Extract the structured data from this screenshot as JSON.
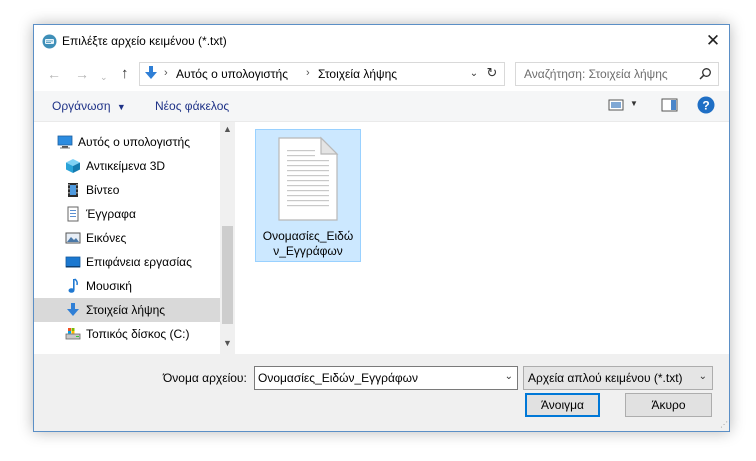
{
  "window": {
    "title": "Επιλέξτε αρχείο κειμένου (*.txt)"
  },
  "navigation": {
    "breadcrumb": [
      "Αυτός ο υπολογιστής",
      "Στοιχεία λήψης"
    ],
    "search_placeholder": "Αναζήτηση: Στοιχεία λήψης"
  },
  "toolbar": {
    "organize_label": "Οργάνωση",
    "new_folder_label": "Νέος φάκελος"
  },
  "sidebar": {
    "items": [
      {
        "label": "Αυτός ο υπολογιστής",
        "icon": "computer-icon"
      },
      {
        "label": "Αντικείμενα 3D",
        "icon": "3d-objects-icon"
      },
      {
        "label": "Βίντεο",
        "icon": "video-icon"
      },
      {
        "label": "Έγγραφα",
        "icon": "documents-icon"
      },
      {
        "label": "Εικόνες",
        "icon": "pictures-icon"
      },
      {
        "label": "Επιφάνεια εργασίας",
        "icon": "desktop-icon"
      },
      {
        "label": "Μουσική",
        "icon": "music-icon"
      },
      {
        "label": "Στοιχεία λήψης",
        "icon": "downloads-icon",
        "selected": true
      },
      {
        "label": "Τοπικός δίσκος (C:)",
        "icon": "drive-icon"
      }
    ]
  },
  "files": [
    {
      "name": "Ονομασίες_Ειδών_Εγγράφων",
      "display_line1": "Ονομασίες_Ειδώ",
      "display_line2": "ν_Εγγράφων",
      "selected": true
    }
  ],
  "footer": {
    "filename_label": "Όνομα αρχείου:",
    "filename_value": "Ονομασίες_Ειδών_Εγγράφων",
    "filetype_value": "Αρχεία απλού κειμένου (*.txt)",
    "open_label": "Άνοιγμα",
    "cancel_label": "Άκυρο"
  },
  "colors": {
    "accent": "#0078d7",
    "selection": "#cce8ff",
    "link": "#1e3287"
  }
}
